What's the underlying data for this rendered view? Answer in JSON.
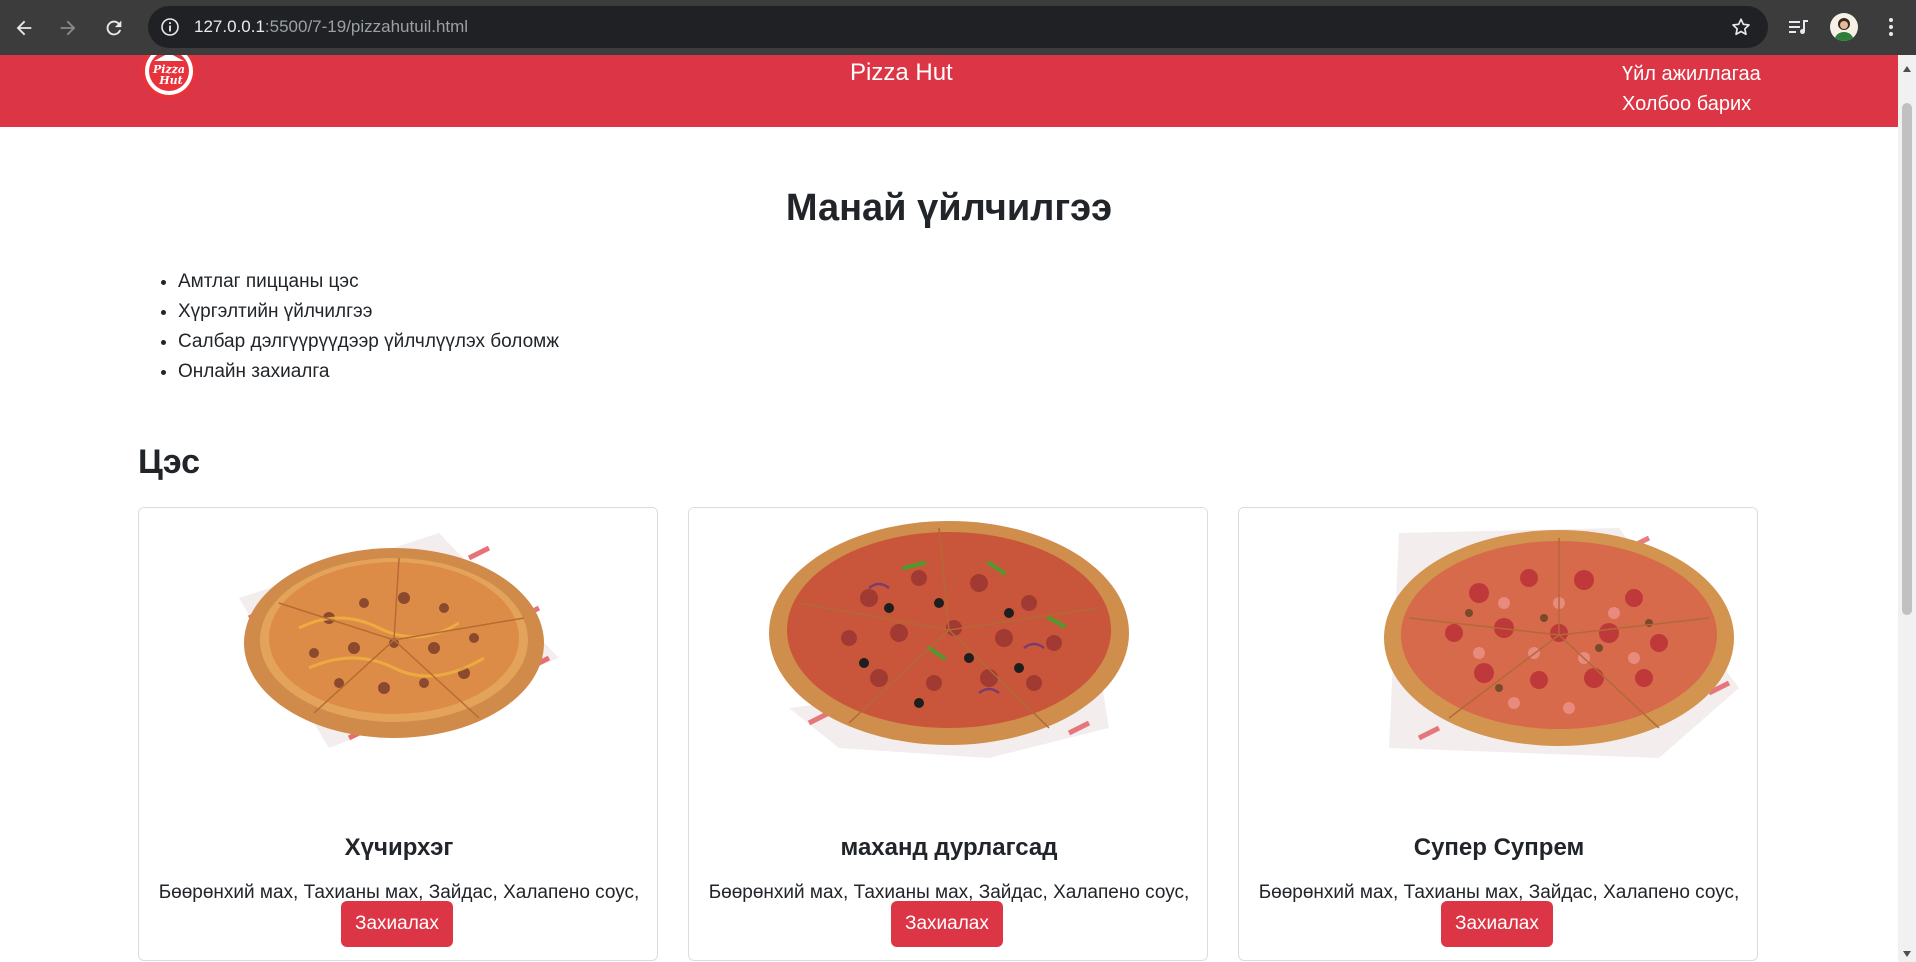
{
  "browser": {
    "url_host": "127.0.0.1",
    "url_rest": ":5500/7-19/pizzahutuil.html"
  },
  "header": {
    "title": "Pizza Hut",
    "logo_text_1": "Pizza",
    "logo_text_2": "Hut",
    "nav": [
      "Үйл ажиллагаа",
      "Холбоо барих"
    ]
  },
  "services": {
    "title": "Манай үйлчилгээ",
    "items": [
      "Амтлаг пиццаны цэс",
      "Хүргэлтийн үйлчилгээ",
      "Салбар дэлгүүрүүдээр үйлчлүүлэх боломж",
      "Онлайн захиалга"
    ]
  },
  "menu": {
    "title": "Цэс",
    "cards": [
      {
        "name": "Хүчирхэг",
        "desc": "Бөөрөнхий мах, Тахианы мах, Зайдас, Халапено соус, Бяслаг",
        "button": "Захиалах"
      },
      {
        "name": "маханд дурлагсад",
        "desc": "Бөөрөнхий мах, Тахианы мах, Зайдас, Халапено соус, Бяслаг",
        "button": "Захиалах"
      },
      {
        "name": "Супер Супрем",
        "desc": "Бөөрөнхий мах, Тахианы мах, Зайдас, Халапено соус, Бяслаг",
        "button": "Захиалах"
      }
    ]
  },
  "colors": {
    "brand_red": "#dc3545",
    "chrome_bg": "#3c3c3c",
    "omnibox_bg": "#202124"
  }
}
